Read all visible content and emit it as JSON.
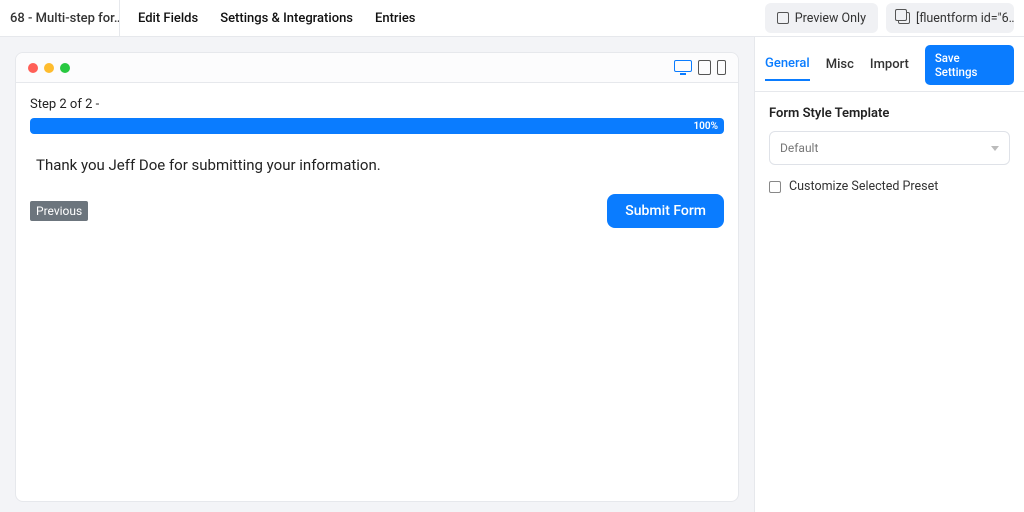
{
  "header": {
    "form_title": "68 - Multi-step for…",
    "nav": {
      "edit": "Edit Fields",
      "settings": "Settings & Integrations",
      "entries": "Entries"
    },
    "preview_toggle": "Preview Only",
    "shortcode": "[fluentform id=\"6…"
  },
  "canvas": {
    "step_label": "Step 2 of 2 -",
    "progress_text": "100%",
    "progress_pct": 100,
    "message": "Thank you Jeff Doe  for submitting your information.",
    "prev_button": "Previous",
    "submit_button": "Submit Form"
  },
  "sidebar": {
    "tabs": {
      "general": "General",
      "misc": "Misc",
      "import": "Import"
    },
    "save": "Save Settings",
    "section_title": "Form Style Template",
    "select_value": "Default",
    "customize_label": "Customize Selected Preset"
  }
}
